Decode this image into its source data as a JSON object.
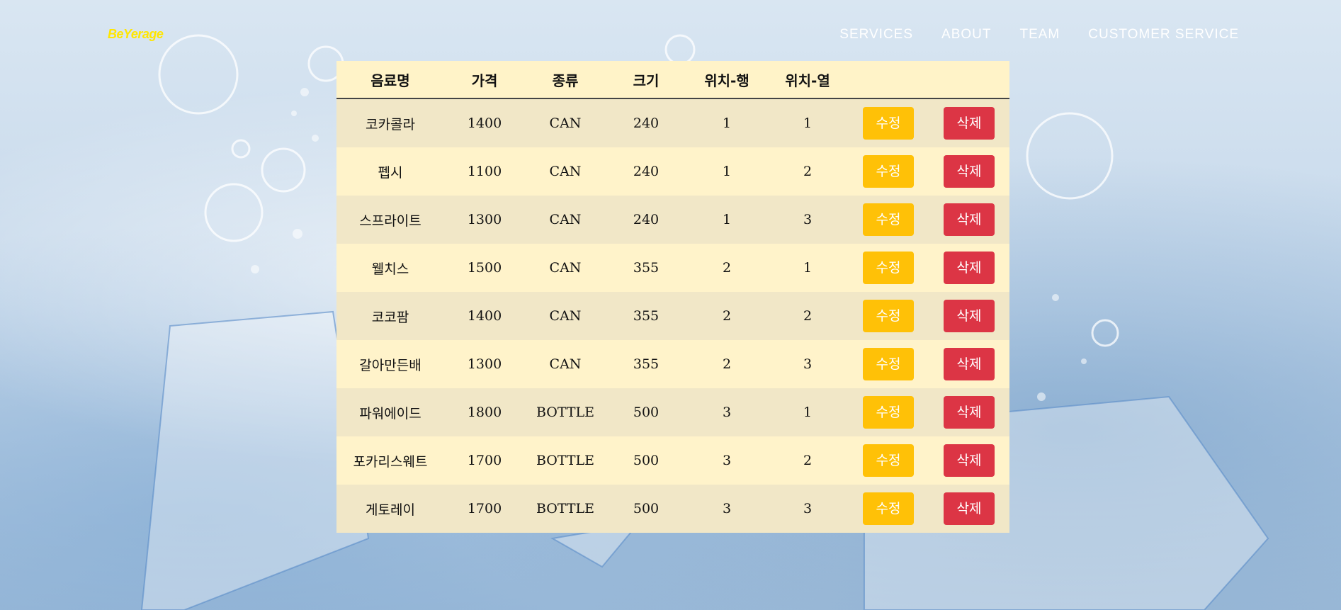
{
  "nav": {
    "logo": "BeYerage",
    "items": [
      "SERVICES",
      "ABOUT",
      "TEAM",
      "CUSTOMER SERVICE"
    ]
  },
  "table": {
    "headers": [
      "음료명",
      "가격",
      "종류",
      "크기",
      "위치-행",
      "위치-열",
      "",
      ""
    ],
    "edit_label": "수정",
    "delete_label": "삭제",
    "rows": [
      {
        "name": "코카콜라",
        "price": "1400",
        "type": "CAN",
        "size": "240",
        "row": "1",
        "col": "1"
      },
      {
        "name": "펩시",
        "price": "1100",
        "type": "CAN",
        "size": "240",
        "row": "1",
        "col": "2"
      },
      {
        "name": "스프라이트",
        "price": "1300",
        "type": "CAN",
        "size": "240",
        "row": "1",
        "col": "3"
      },
      {
        "name": "웰치스",
        "price": "1500",
        "type": "CAN",
        "size": "355",
        "row": "2",
        "col": "1"
      },
      {
        "name": "코코팜",
        "price": "1400",
        "type": "CAN",
        "size": "355",
        "row": "2",
        "col": "2"
      },
      {
        "name": "갈아만든배",
        "price": "1300",
        "type": "CAN",
        "size": "355",
        "row": "2",
        "col": "3"
      },
      {
        "name": "파워에이드",
        "price": "1800",
        "type": "BOTTLE",
        "size": "500",
        "row": "3",
        "col": "1"
      },
      {
        "name": "포카리스웨트",
        "price": "1700",
        "type": "BOTTLE",
        "size": "500",
        "row": "3",
        "col": "2"
      },
      {
        "name": "게토레이",
        "price": "1700",
        "type": "BOTTLE",
        "size": "500",
        "row": "3",
        "col": "3"
      }
    ]
  },
  "colors": {
    "logo": "#ffe600",
    "header_bg": "#fff3c8",
    "row_odd": "#f1e7c7",
    "row_even": "#fff3ca",
    "edit_button": "#ffc107",
    "delete_button": "#dc3545"
  }
}
